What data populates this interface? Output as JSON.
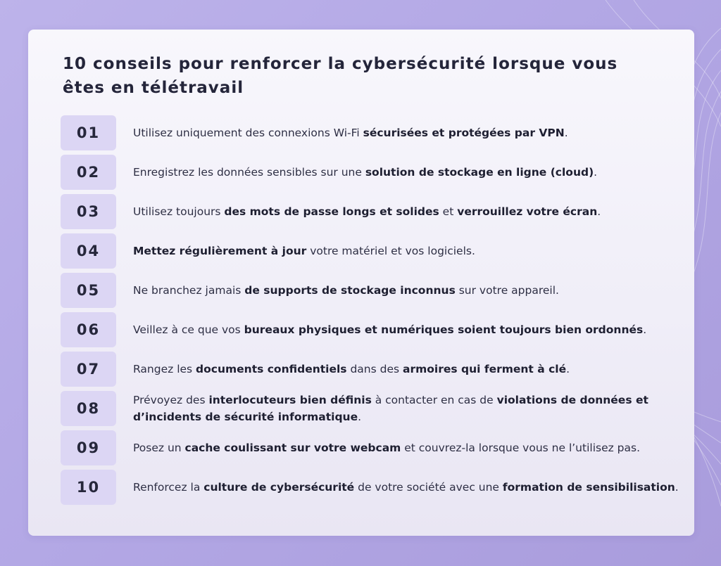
{
  "title": "10 conseils pour renforcer la cybersécurité lorsque vous êtes en télétravail",
  "tips": [
    {
      "num": "01",
      "parts": [
        {
          "t": "Utilisez uniquement des connexions Wi-Fi ",
          "b": false
        },
        {
          "t": "sécurisées et protégées par VPN",
          "b": true
        },
        {
          "t": ".",
          "b": false
        }
      ]
    },
    {
      "num": "02",
      "parts": [
        {
          "t": "Enregistrez les données sensibles sur une ",
          "b": false
        },
        {
          "t": "solution de stockage en ligne (cloud)",
          "b": true
        },
        {
          "t": ".",
          "b": false
        }
      ]
    },
    {
      "num": "03",
      "parts": [
        {
          "t": "Utilisez toujours ",
          "b": false
        },
        {
          "t": "des mots de passe longs et solides",
          "b": true
        },
        {
          "t": " et ",
          "b": false
        },
        {
          "t": "verrouillez votre écran",
          "b": true
        },
        {
          "t": ".",
          "b": false
        }
      ]
    },
    {
      "num": "04",
      "parts": [
        {
          "t": "Mettez régulièrement à jour",
          "b": true
        },
        {
          "t": " votre matériel et vos logiciels.",
          "b": false
        }
      ]
    },
    {
      "num": "05",
      "parts": [
        {
          "t": "Ne branchez jamais ",
          "b": false
        },
        {
          "t": "de supports de stockage inconnus",
          "b": true
        },
        {
          "t": " sur votre appareil.",
          "b": false
        }
      ]
    },
    {
      "num": "06",
      "parts": [
        {
          "t": "Veillez à ce que vos ",
          "b": false
        },
        {
          "t": "bureaux physiques et numériques soient toujours bien ordonnés",
          "b": true
        },
        {
          "t": ".",
          "b": false
        }
      ]
    },
    {
      "num": "07",
      "parts": [
        {
          "t": "Rangez les ",
          "b": false
        },
        {
          "t": "documents confidentiels",
          "b": true
        },
        {
          "t": " dans des ",
          "b": false
        },
        {
          "t": "armoires qui ferment à clé",
          "b": true
        },
        {
          "t": ".",
          "b": false
        }
      ]
    },
    {
      "num": "08",
      "parts": [
        {
          "t": "Prévoyez des ",
          "b": false
        },
        {
          "t": "interlocuteurs bien définis",
          "b": true
        },
        {
          "t": " à contacter en cas de ",
          "b": false
        },
        {
          "t": "violations de données et d’incidents de sécurité informatique",
          "b": true
        },
        {
          "t": ".",
          "b": false
        }
      ]
    },
    {
      "num": "09",
      "parts": [
        {
          "t": "Posez un ",
          "b": false
        },
        {
          "t": "cache coulissant sur votre webcam",
          "b": true
        },
        {
          "t": " et couvrez-la lorsque vous ne l’utilisez pas.",
          "b": false
        }
      ]
    },
    {
      "num": "10",
      "parts": [
        {
          "t": "Renforcez la ",
          "b": false
        },
        {
          "t": "culture de cybersécurité",
          "b": true
        },
        {
          "t": " de votre société avec une ",
          "b": false
        },
        {
          "t": "formation de sensibilisation",
          "b": true
        },
        {
          "t": ".",
          "b": false
        }
      ]
    }
  ]
}
